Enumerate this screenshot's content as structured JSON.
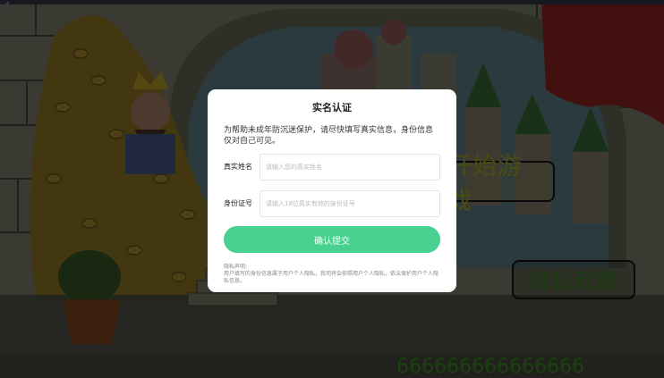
{
  "game": {
    "start_button": "开始游戏",
    "privacy_button": "隐私政策",
    "counter": "666666666666666",
    "sound_icon": "speaker-icon"
  },
  "dialog": {
    "title": "实名认证",
    "description": "为帮助未成年防沉迷保护，请尽快填写真实信息，身份信息仅对自己可见。",
    "name_label": "真实姓名",
    "name_placeholder": "请输入您的真实姓名",
    "id_label": "身份证号",
    "id_placeholder": "请输入18位真实有效的身份证号",
    "submit_label": "确认提交",
    "privacy_title": "隐私声明:",
    "privacy_text": "用户填写的身份信息属于用户个人隐私，我司将会依照用户个人隐私，依法保护用户个人隐私信息。"
  },
  "colors": {
    "accent": "#47d08e",
    "overlay": "rgba(0,0,0,0.45)"
  }
}
